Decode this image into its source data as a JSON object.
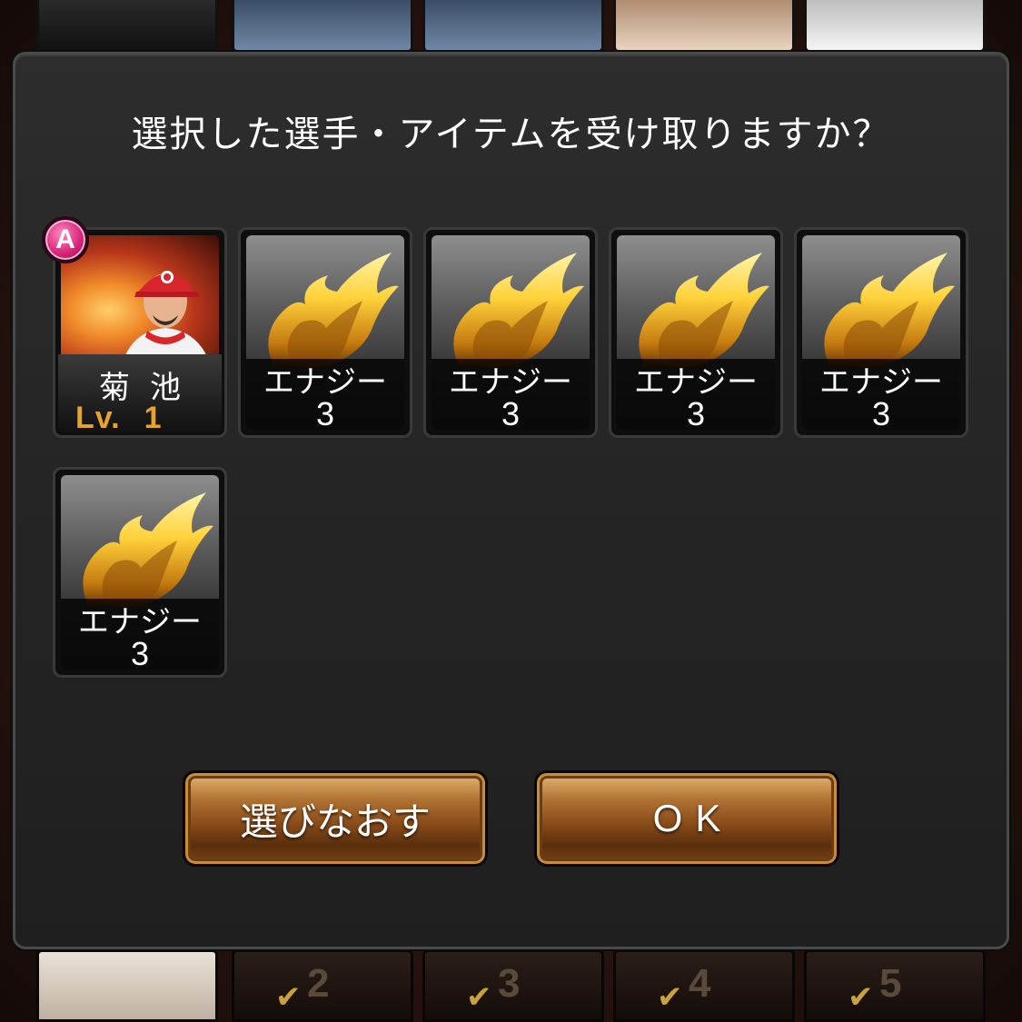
{
  "dialog": {
    "title": "選択した選手・アイテムを受け取りますか？"
  },
  "player": {
    "rank": "A",
    "name": "菊池",
    "level_label": "Lv.",
    "level_value": "1"
  },
  "items": [
    {
      "name": "エナジー",
      "count": "3",
      "icon": "flame-icon"
    },
    {
      "name": "エナジー",
      "count": "3",
      "icon": "flame-icon"
    },
    {
      "name": "エナジー",
      "count": "3",
      "icon": "flame-icon"
    },
    {
      "name": "エナジー",
      "count": "3",
      "icon": "flame-icon"
    },
    {
      "name": "エナジー",
      "count": "3",
      "icon": "flame-icon"
    }
  ],
  "buttons": {
    "reselect": "選びなおす",
    "ok": "OK"
  },
  "background": {
    "slot_numbers": [
      "2",
      "3",
      "4",
      "5"
    ]
  },
  "colors": {
    "level_text": "#e8a32a",
    "rank_badge": "#d9257a",
    "button_gold": "#b27434",
    "dialog_bg": "#262626"
  }
}
